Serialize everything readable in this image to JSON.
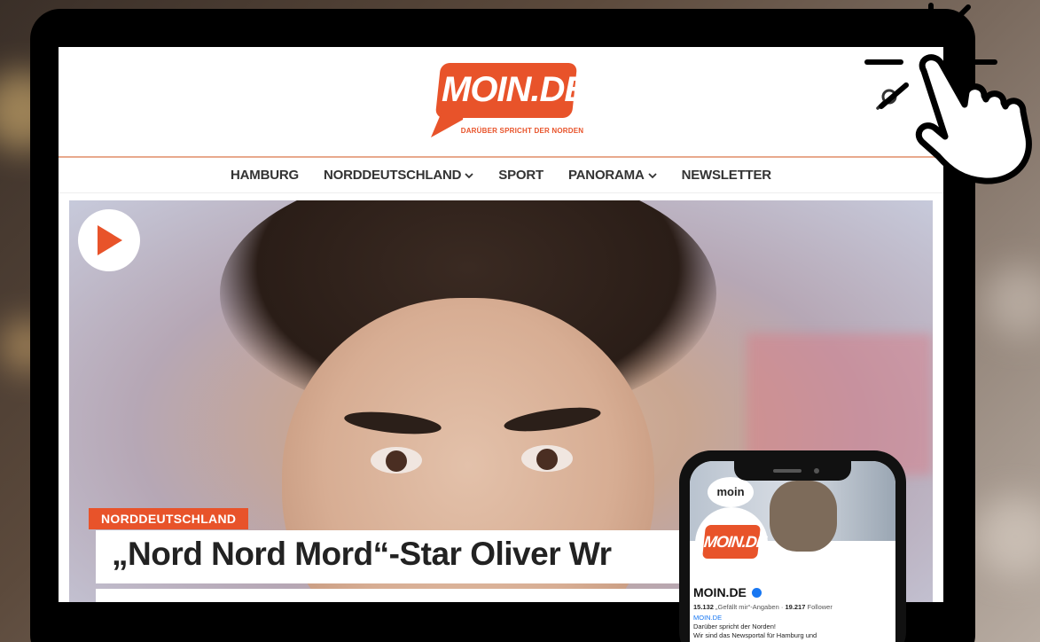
{
  "site": {
    "logo_text": "MOIN.DE",
    "tagline": "DARÜBER SPRICHT DER NORDEN",
    "brand_color": "#e8532a"
  },
  "nav": {
    "items": [
      {
        "label": "HAMBURG",
        "dropdown": false
      },
      {
        "label": "NORDDEUTSCHLAND",
        "dropdown": true
      },
      {
        "label": "SPORT",
        "dropdown": false
      },
      {
        "label": "PANORAMA",
        "dropdown": true
      },
      {
        "label": "NEWSLETTER",
        "dropdown": false
      }
    ]
  },
  "hero": {
    "category": "NORDDEUTSCHLAND",
    "headline": "„Nord Nord Mord“-Star Oliver Wr"
  },
  "phone": {
    "cover_bubble": "moin",
    "avatar_logo": "MOIN.DE",
    "page_name": "MOIN.DE",
    "likes_count": "15.132",
    "likes_label": "„Gefällt mir“-Angaben",
    "separator": "·",
    "followers_count": "19.217",
    "followers_label": "Follower",
    "link": "MOIN.DE",
    "bio_line1": "Darüber spricht der Norden!",
    "bio_line2": "Wir sind das Newsportal für Hamburg und"
  },
  "icons": {
    "search": "search-icon",
    "play": "play-icon",
    "pointer": "hand-pointer-icon",
    "chevron": "chevron-down-icon",
    "verified": "verified-badge-icon"
  }
}
